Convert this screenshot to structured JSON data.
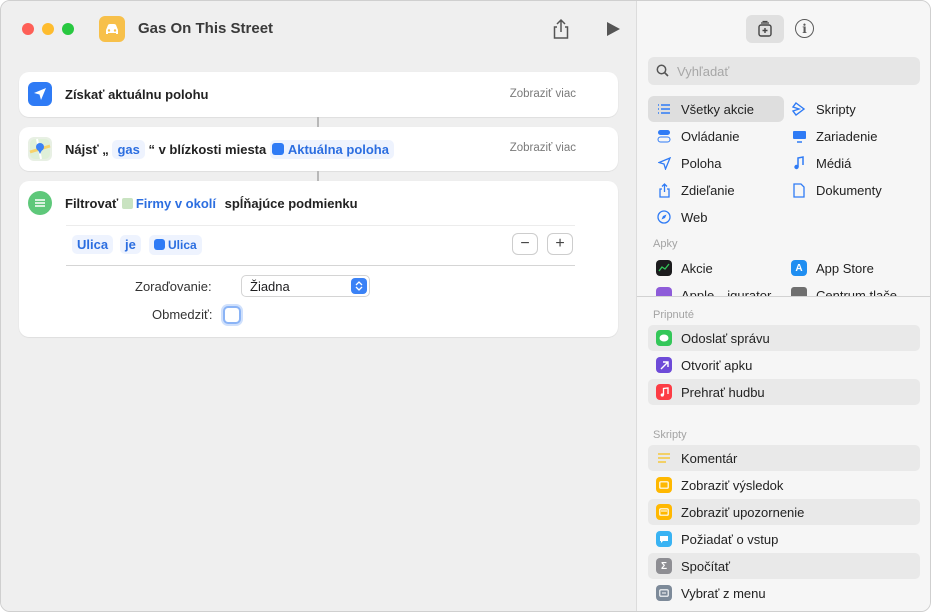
{
  "window": {
    "title": "Gas On This Street"
  },
  "actions": {
    "get_location": {
      "label": "Získať aktuálnu polohu",
      "show_more": "Zobraziť viac"
    },
    "find": {
      "prefix": "Nájsť „",
      "query": "gas",
      "middle": "“ v blízkosti miesta",
      "location_token": "Aktuálna poloha",
      "show_more": "Zobraziť viac"
    },
    "filter": {
      "prefix": "Filtrovať",
      "token": "Firmy v okolí",
      "suffix": "spĺňajúce podmienku",
      "condition_field": "Ulica",
      "condition_op": "je",
      "condition_value": "Ulica",
      "minus": "−",
      "plus": "+",
      "sort_label": "Zoraďovanie:",
      "sort_value": "Žiadna",
      "limit_label": "Obmedziť:"
    }
  },
  "sidebar": {
    "search_placeholder": "Vyhľadať",
    "categories": [
      {
        "label": "Všetky akcie",
        "icon": "list-icon"
      },
      {
        "label": "Skripty",
        "icon": "script-icon"
      },
      {
        "label": "Ovládanie",
        "icon": "toggle-icon"
      },
      {
        "label": "Zariadenie",
        "icon": "monitor-icon"
      },
      {
        "label": "Poloha",
        "icon": "location-arrow-icon"
      },
      {
        "label": "Médiá",
        "icon": "music-note-icon"
      },
      {
        "label": "Zdieľanie",
        "icon": "share-icon"
      },
      {
        "label": "Dokumenty",
        "icon": "document-icon"
      },
      {
        "label": "Web",
        "icon": "compass-icon"
      }
    ],
    "apps_header": "Apky",
    "apps": [
      {
        "label": "Akcie",
        "icon": "stocks-icon"
      },
      {
        "label": "App Store",
        "icon": "app-store-icon"
      },
      {
        "label": "Apple…igurator",
        "icon": "configurator-icon"
      },
      {
        "label": "Centrum tlače",
        "icon": "printer-icon"
      }
    ],
    "pinned_header": "Pripnuté",
    "pinned": [
      {
        "label": "Odoslať správu",
        "color": "#34c759",
        "icon": "message-icon"
      },
      {
        "label": "Otvoriť apku",
        "color": "#6e4bd8",
        "icon": "open-app-icon"
      },
      {
        "label": "Prehrať hudbu",
        "color": "#fc3c44",
        "icon": "music-icon"
      }
    ],
    "scripts_header": "Skripty",
    "scripts": [
      {
        "label": "Komentár",
        "color": "#f6d34a",
        "icon": "comment-lines-icon"
      },
      {
        "label": "Zobraziť výsledok",
        "color": "#ffb800",
        "icon": "show-result-icon"
      },
      {
        "label": "Zobraziť upozornenie",
        "color": "#ffb800",
        "icon": "alert-icon"
      },
      {
        "label": "Požiadať o vstup",
        "color": "#39b3f3",
        "icon": "input-icon"
      },
      {
        "label": "Spočítať",
        "color": "#8e8e93",
        "icon": "sigma-icon"
      },
      {
        "label": "Vybrať z menu",
        "color": "#7d8a99",
        "icon": "menu-icon"
      }
    ]
  },
  "colors": {
    "accent": "#2c6ee0",
    "close": "#fe5f57",
    "minimize": "#febc2e",
    "zoom": "#28c840"
  }
}
